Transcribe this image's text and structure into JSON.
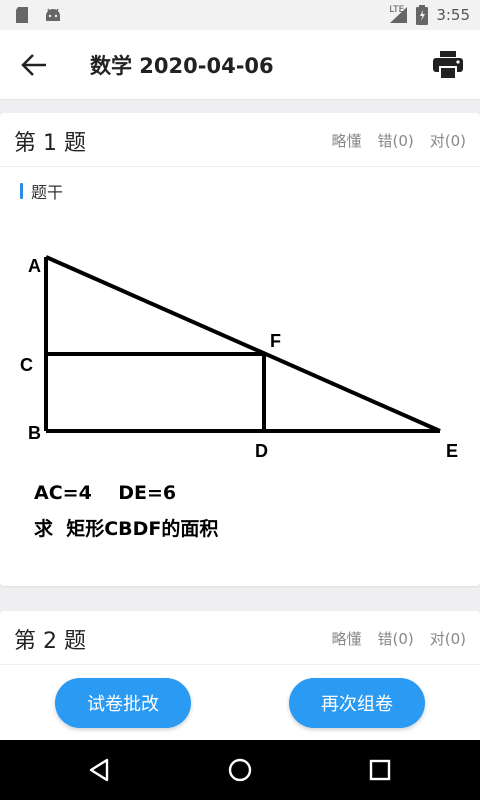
{
  "status_bar": {
    "time": "3:55",
    "network": "LTE",
    "icons": [
      "sd-card-icon",
      "android-icon",
      "signal-icon",
      "battery-icon"
    ]
  },
  "app_bar": {
    "title": "数学 2020-04-06",
    "back_icon": "arrow-left-icon",
    "print_icon": "printer-icon"
  },
  "questions": [
    {
      "title": "第 1 题",
      "actions": [
        "略懂",
        "错(0)",
        "对(0)"
      ],
      "stem_label": "题干",
      "figure": {
        "point_labels": {
          "A": "A",
          "B": "B",
          "C": "C",
          "D": "D",
          "E": "E",
          "F": "F"
        },
        "given": "AC=4    DE=6",
        "question": "求  矩形CBDF的面积"
      }
    },
    {
      "title": "第 2 题",
      "actions": [
        "略懂",
        "错(0)",
        "对(0)"
      ]
    }
  ],
  "bottom_buttons": {
    "grade_label": "试卷批改",
    "regroup_label": "再次组卷"
  },
  "nav_bar": {
    "icons": [
      "back-triangle-icon",
      "home-circle-icon",
      "recents-square-icon"
    ]
  },
  "colors": {
    "accent": "#2b9af3",
    "stem_bar": "#2b8de8",
    "background": "#efeff1"
  }
}
